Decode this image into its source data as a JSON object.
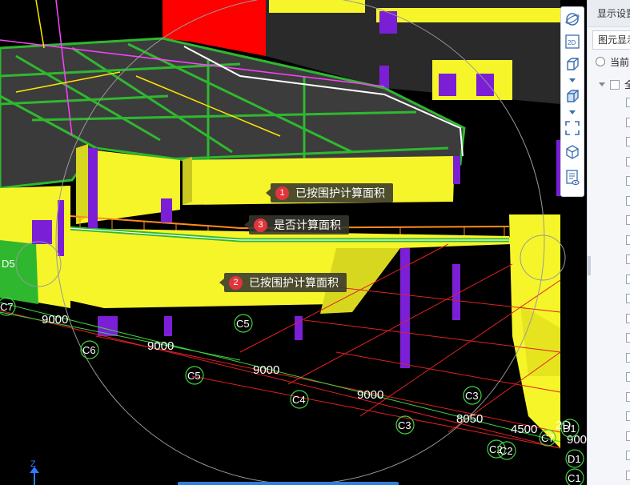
{
  "callouts": [
    {
      "number": "1",
      "text": "已按围护计算面积"
    },
    {
      "number": "3",
      "text": "是否计算面积"
    },
    {
      "number": "2",
      "text": "已按围护计算面积"
    }
  ],
  "grid_labels": [
    {
      "text": "9000"
    },
    {
      "text": "9000"
    },
    {
      "text": "9000"
    },
    {
      "text": "9000"
    },
    {
      "text": "8050"
    },
    {
      "text": "4500"
    },
    {
      "text": "900"
    },
    {
      "text": "2D"
    }
  ],
  "axis_markers": [
    {
      "text": "C7"
    },
    {
      "text": "C6"
    },
    {
      "text": "C5"
    },
    {
      "text": "C5"
    },
    {
      "text": "C4"
    },
    {
      "text": "C3"
    },
    {
      "text": "C3"
    },
    {
      "text": "C2"
    },
    {
      "text": "C2"
    },
    {
      "text": "D1"
    },
    {
      "text": "D1"
    },
    {
      "text": "C1"
    },
    {
      "text": "D5"
    },
    {
      "text": "C7"
    }
  ],
  "zaxis_label": "Z",
  "toolbar": {
    "items": [
      {
        "name": "orbit-icon"
      },
      {
        "name": "2d-view-icon",
        "label": "2D"
      },
      {
        "name": "3d-box-icon"
      },
      {
        "name": "solid-cube-icon"
      },
      {
        "name": "fit-view-icon"
      },
      {
        "name": "cube-navigator-icon"
      },
      {
        "name": "display-list-icon"
      }
    ]
  },
  "panel": {
    "title": "显示设置",
    "tab": "图元显示",
    "radio_label": "当前",
    "tree_root_label": "全"
  },
  "colors": {
    "slab": "#3c3c3c",
    "beam": "#2fb82f",
    "wall": "#f6f52a",
    "column": "#7a1fd6",
    "axis": "#e02020",
    "red_block": "#ff0000"
  }
}
